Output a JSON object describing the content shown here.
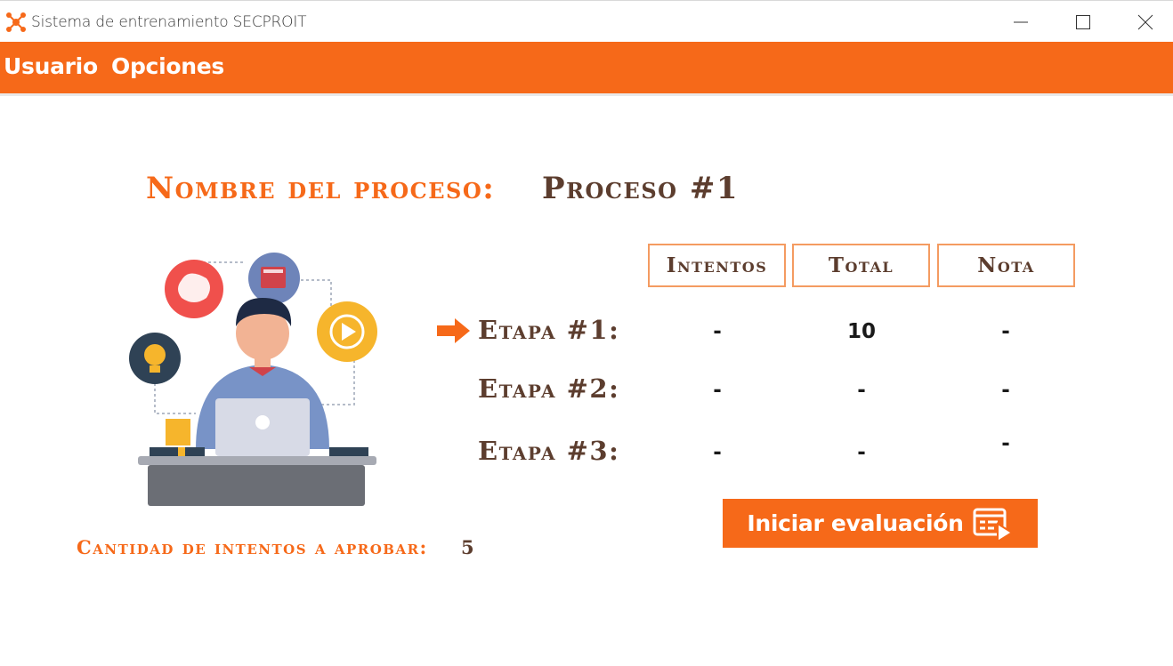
{
  "window": {
    "title": "Sistema de entrenamiento SECPROIT",
    "controls": [
      "minimize-icon",
      "maximize-icon",
      "close-icon"
    ]
  },
  "menu": {
    "items": [
      {
        "label": "Usuario"
      },
      {
        "label": "Opciones"
      }
    ]
  },
  "process": {
    "label": "Nombre del proceso:",
    "value": "Proceso #1"
  },
  "table": {
    "headers": [
      "Intentos",
      "Total",
      "Nota"
    ],
    "rows": [
      {
        "stage": "Etapa #1:",
        "intentos": "-",
        "total": "10",
        "nota": "-",
        "current": true
      },
      {
        "stage": "Etapa #2:",
        "intentos": "-",
        "total": "-",
        "nota": "-",
        "current": false
      },
      {
        "stage": "Etapa #3:",
        "intentos": "-",
        "total": "-",
        "nota": "-",
        "current": false
      }
    ]
  },
  "start_button": {
    "label": "Iniciar evaluación",
    "icon": "start-evaluation-icon"
  },
  "attempts": {
    "label": "Cantidad de intentos a aprobar:",
    "value": "5"
  },
  "colors": {
    "accent": "#f66919",
    "text_brown": "#5c3d2e",
    "border": "#f49b61"
  }
}
